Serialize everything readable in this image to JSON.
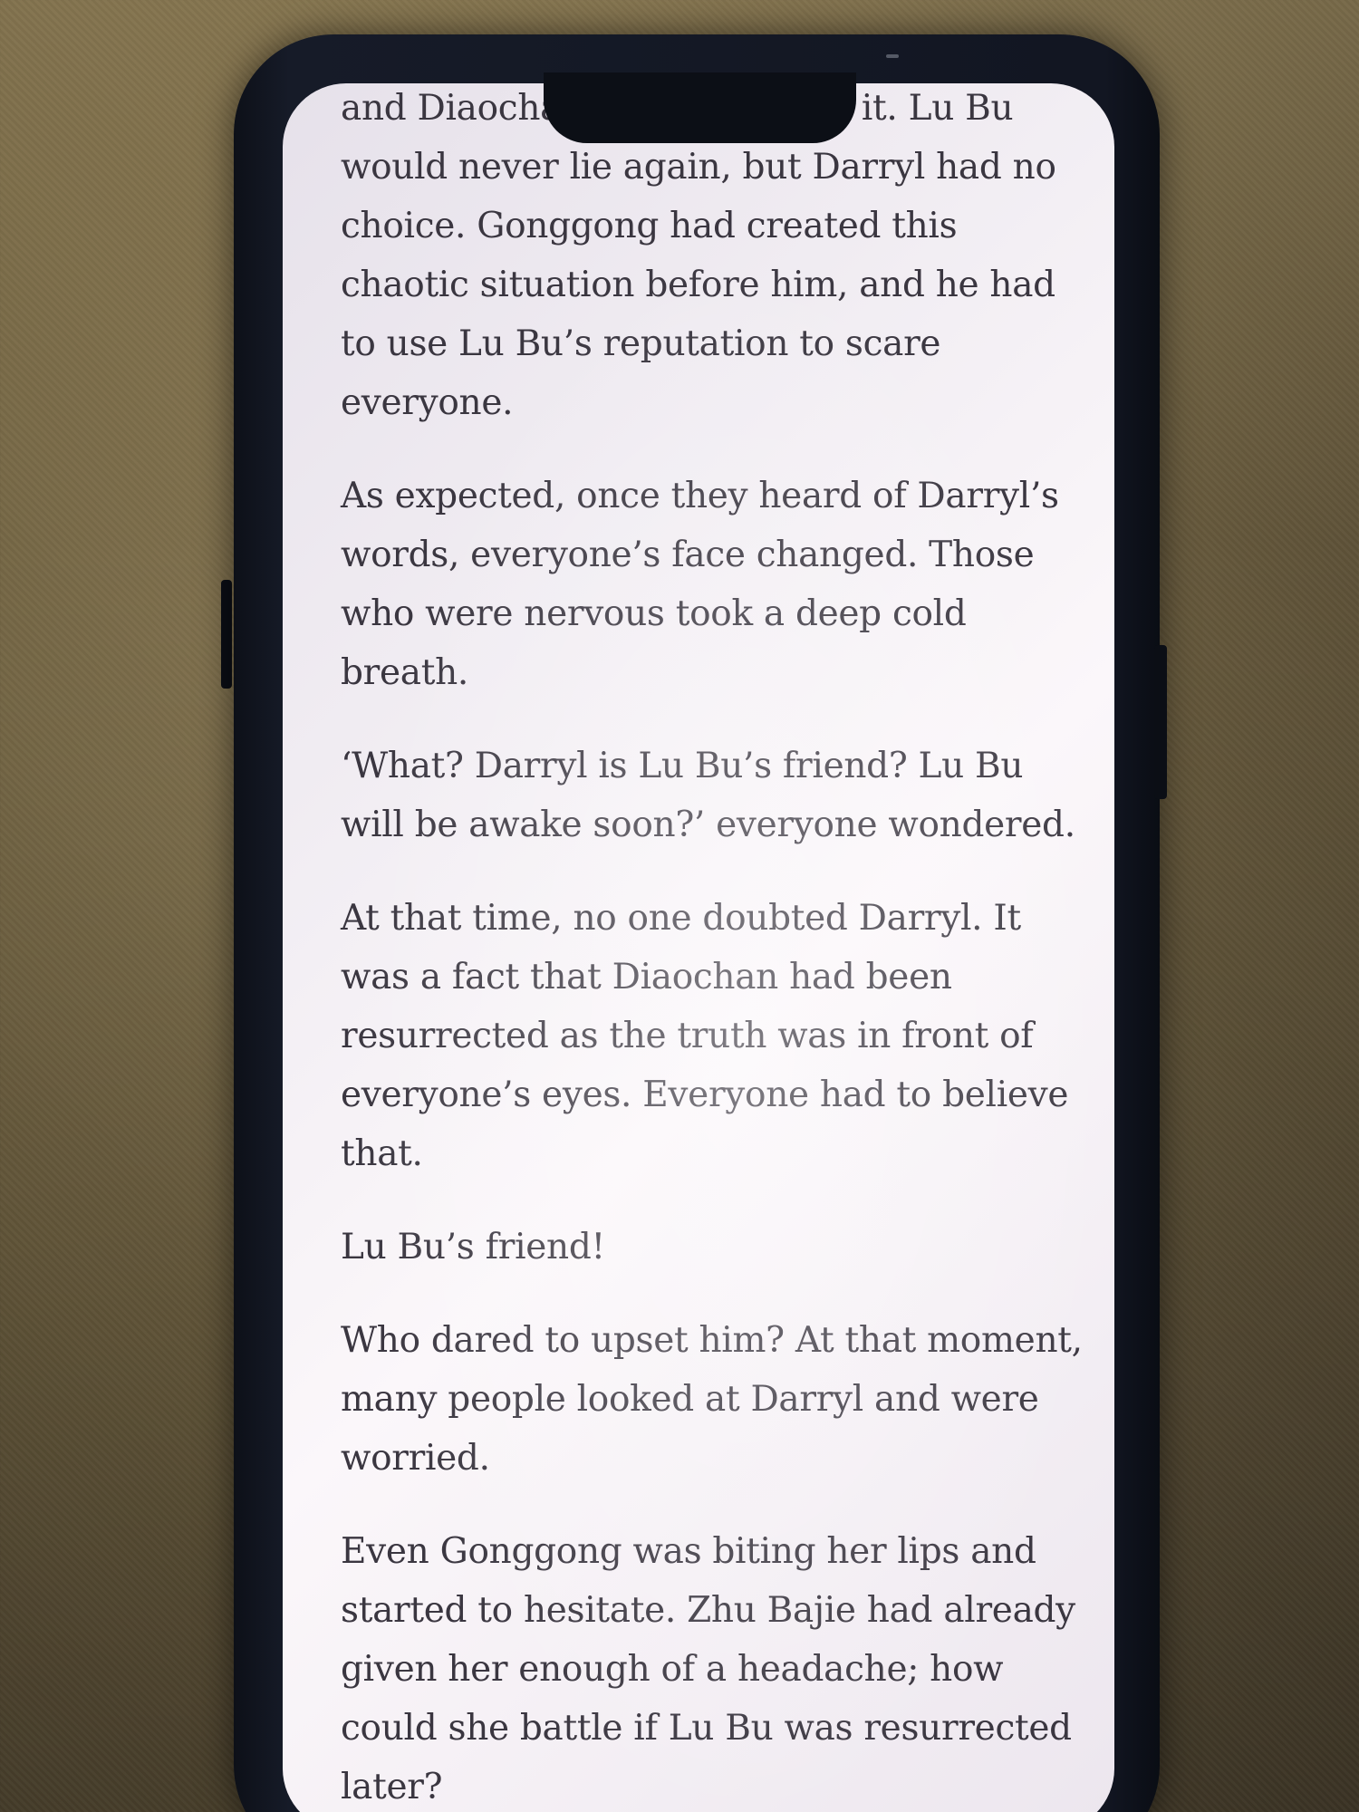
{
  "article": {
    "paragraphs": [
      "and Diaochan had consumed it. Lu Bu would never lie again, but Darryl had no choice. Gonggong had created this chaotic situation before him, and he had to use Lu Bu’s reputation to scare everyone.",
      "As expected, once they heard of Darryl’s words, everyone’s face changed. Those who were nervous took a deep cold breath.",
      "‘What? Darryl is Lu Bu’s friend? Lu Bu will be awake soon?’ everyone wondered.",
      "At that time, no one doubted Darryl. It was a fact that Diaochan had been resurrected as the truth was in front of everyone’s eyes. Everyone had to believe that.",
      "Lu Bu’s friend!",
      "Who dared to upset him? At that moment, many people looked at Darryl and were worried.",
      "Even Gonggong was biting her lips and started to hesitate. Zhu Bajie had already given her enough of a headache; how could she battle if Lu Bu was resurrected later?"
    ]
  }
}
